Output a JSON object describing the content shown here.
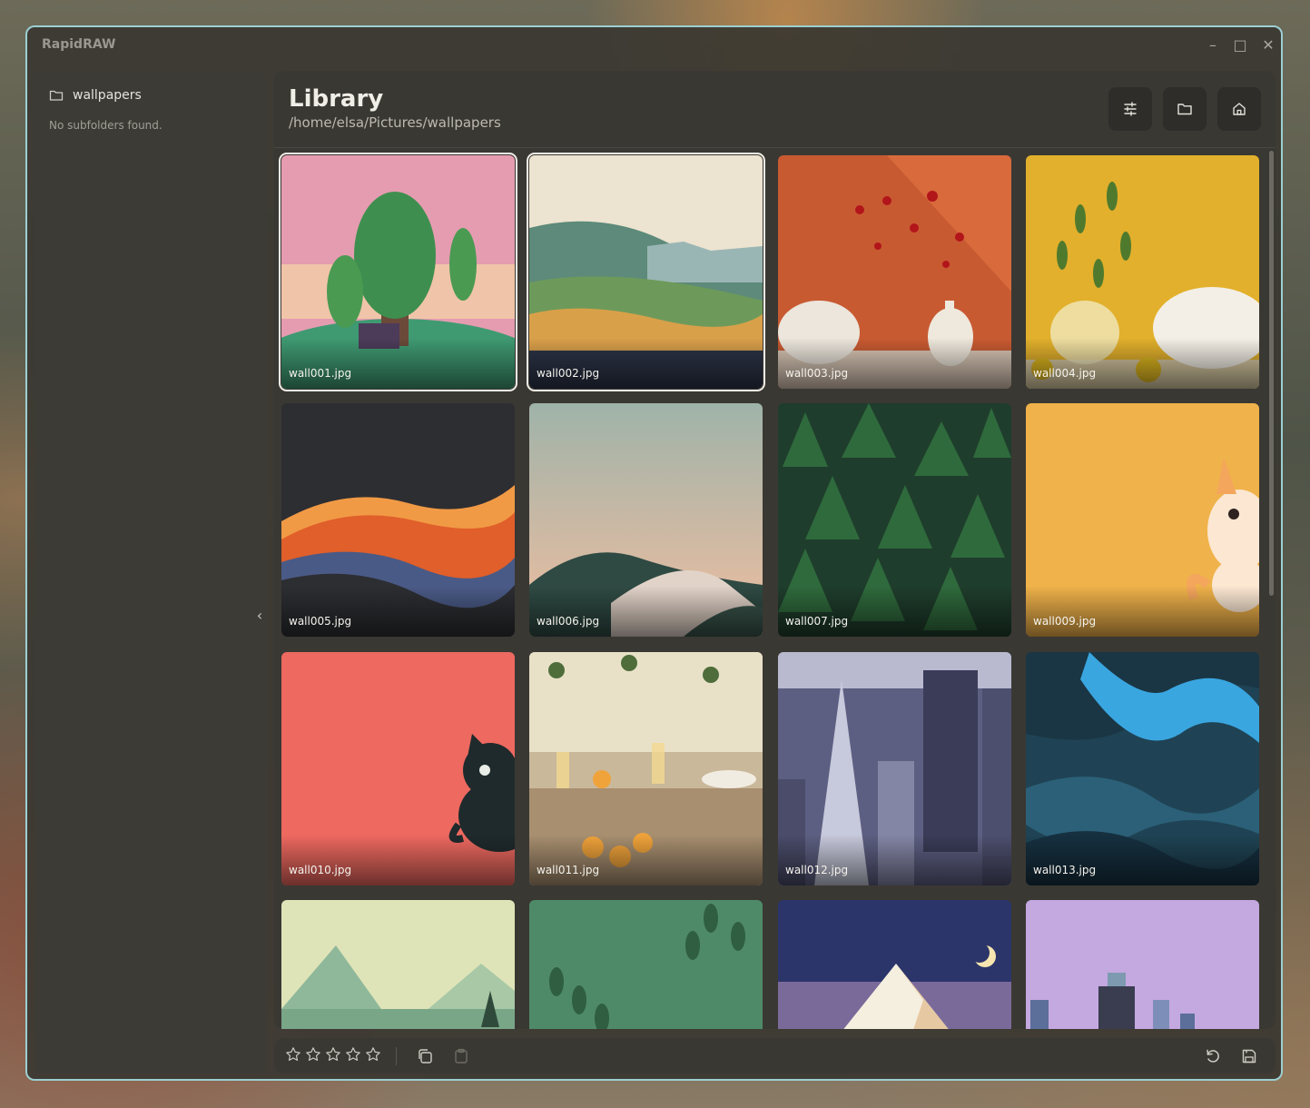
{
  "window": {
    "title": "RapidRAW",
    "frame_color": "#9ccfd2"
  },
  "window_controls": [
    {
      "name": "minimize-icon",
      "glyph": "–"
    },
    {
      "name": "maximize-icon",
      "glyph": "□"
    },
    {
      "name": "close-icon",
      "glyph": "✕"
    }
  ],
  "sidebar": {
    "folder_name": "wallpapers",
    "empty_message": "No subfolders found.",
    "collapse_glyph": "‹"
  },
  "library": {
    "title": "Library",
    "path": "/home/elsa/Pictures/wallpapers",
    "header_buttons": [
      "sliders-icon",
      "folder-icon",
      "home-icon"
    ]
  },
  "images": [
    {
      "file": "wall001.jpg",
      "selected": true
    },
    {
      "file": "wall002.jpg",
      "selected": true
    },
    {
      "file": "wall003.jpg",
      "selected": false
    },
    {
      "file": "wall004.jpg",
      "selected": false
    },
    {
      "file": "wall005.jpg",
      "selected": false
    },
    {
      "file": "wall006.jpg",
      "selected": false
    },
    {
      "file": "wall007.jpg",
      "selected": false
    },
    {
      "file": "wall009.jpg",
      "selected": false
    },
    {
      "file": "wall010.jpg",
      "selected": false
    },
    {
      "file": "wall011.jpg",
      "selected": false
    },
    {
      "file": "wall012.jpg",
      "selected": false
    },
    {
      "file": "wall013.jpg",
      "selected": false
    },
    {
      "file": "",
      "selected": false
    },
    {
      "file": "",
      "selected": false
    },
    {
      "file": "",
      "selected": false
    },
    {
      "file": "",
      "selected": false
    }
  ],
  "bottom_bar": {
    "rating": 0,
    "rating_max": 5,
    "icons": [
      "copy-icon",
      "paste-icon",
      "reset-icon",
      "save-icon"
    ]
  }
}
